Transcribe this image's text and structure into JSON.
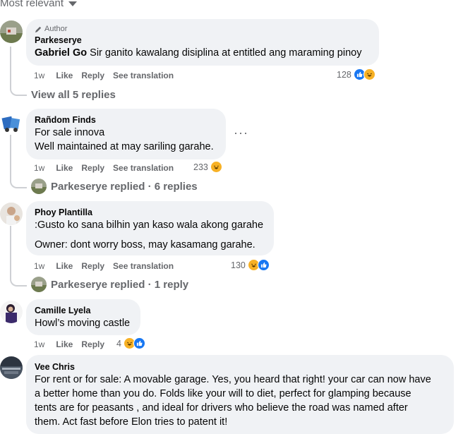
{
  "sort": {
    "label": "Most relevant"
  },
  "comments": [
    {
      "badge": "Author",
      "name": "Parkeserye",
      "mention": "Gabriel Go",
      "text": " Sir ganito kawalang disiplina at entitled ang maraming pinoy",
      "time": "1w",
      "like": "Like",
      "reply": "Reply",
      "translate": "See translation",
      "reactions": "128",
      "view_replies": "View all 5 replies"
    },
    {
      "name": "Rañdom Finds",
      "line1": "For sale innova",
      "line2": "Well maintained at may sariling garahe.",
      "more": "···",
      "time": "1w",
      "like": "Like",
      "reply": "Reply",
      "translate": "See translation",
      "reactions": "233",
      "replied": "Parkeserye replied · 6 replies"
    },
    {
      "name": "Phoy Plantilla",
      "line1": ":Gusto ko sana bilhin yan kaso wala akong garahe",
      "line2": "Owner: dont worry boss, may kasamang garahe.",
      "time": "1w",
      "like": "Like",
      "reply": "Reply",
      "translate": "See translation",
      "reactions": "130",
      "replied": "Parkeserye replied · 1 reply"
    },
    {
      "name": "Camille Lyela",
      "line1": "Howl’s moving castle",
      "time": "1w",
      "like": "Like",
      "reply": "Reply",
      "reactions": "4"
    },
    {
      "name": "Vee Chris",
      "line1": "For rent or for sale: A movable garage. Yes, you heard that right! your car can now have",
      "line2": "a better home than you do. Folds like your will to diet, perfect for glamping because",
      "line3": "tents are for peasants , and ideal for drivers who believe the road was named after",
      "line4": "them. Act fast before Elon tries to patent it!"
    }
  ],
  "colors": {
    "like": "#1877f2",
    "haha": "#f7b125",
    "bubble": "#f0f2f5",
    "meta": "#65676b"
  }
}
